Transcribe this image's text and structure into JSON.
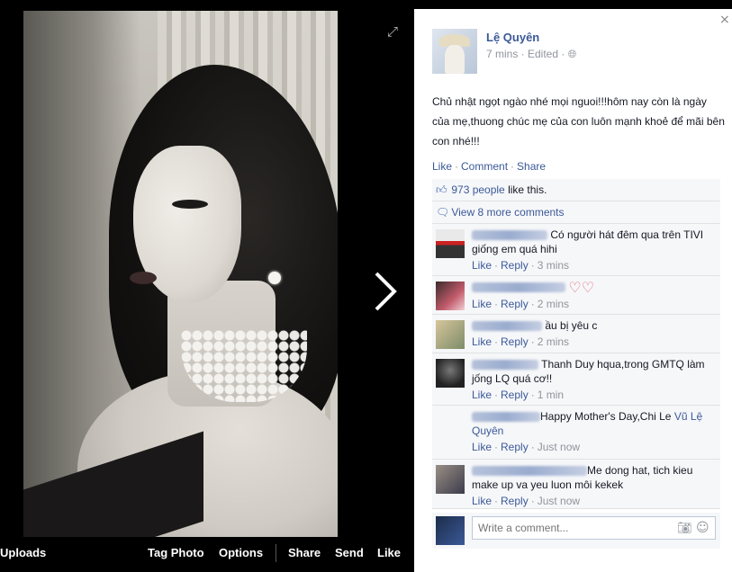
{
  "photo_viewer": {
    "bar": {
      "uploads": "Uploads",
      "tag_photo": "Tag Photo",
      "options": "Options",
      "share": "Share",
      "send": "Send",
      "like": "Like"
    },
    "icons": {
      "expand": "expand-icon",
      "next": "chevron-right-icon"
    }
  },
  "post": {
    "author": "Lệ Quyên",
    "meta": "7 mins · Edited · ",
    "audience_icon": "globe-icon",
    "text": "Chủ nhật ngọt ngào nhé mọi nguoi!!!hôm nay còn là ngày của mẹ,thuong chúc mẹ của con luôn mạnh khoẻ để mãi bên con nhé!!!",
    "actions": {
      "like": "Like",
      "comment": "Comment",
      "share": "Share"
    },
    "likes_count": "973 people",
    "likes_suffix": "like this.",
    "view_more": "View 8 more comments"
  },
  "comments": [
    {
      "text": "Có người hát đêm qua trên TIVI giống em quá hihi",
      "like": "Like",
      "reply": "Reply",
      "time": "3 mins"
    },
    {
      "text": "",
      "like": "Like",
      "reply": "Reply",
      "time": "2 mins",
      "hearts": "♡♡"
    },
    {
      "text": "ầu bị yêu c",
      "like": "Like",
      "reply": "Reply",
      "time": "2 mins"
    },
    {
      "text": "Thanh Duy hqua,trong GMTQ làm jống LQ quá cơ!!",
      "like": "Like",
      "reply": "Reply",
      "time": "1 min"
    },
    {
      "text": "Happy Mother's Day,Chi Le",
      "mention": "Vũ Lệ Quyên",
      "like": "Like",
      "reply": "Reply",
      "time": "Just now"
    },
    {
      "text": "Me dong hat, tich kieu make up va yeu luon môi kekek",
      "like": "Like",
      "reply": "Reply",
      "time": "Just now"
    }
  ],
  "composer": {
    "placeholder": "Write a comment...",
    "camera_icon": "camera-icon",
    "emoji_icon": "emoji-icon"
  },
  "close_symbol": "×"
}
